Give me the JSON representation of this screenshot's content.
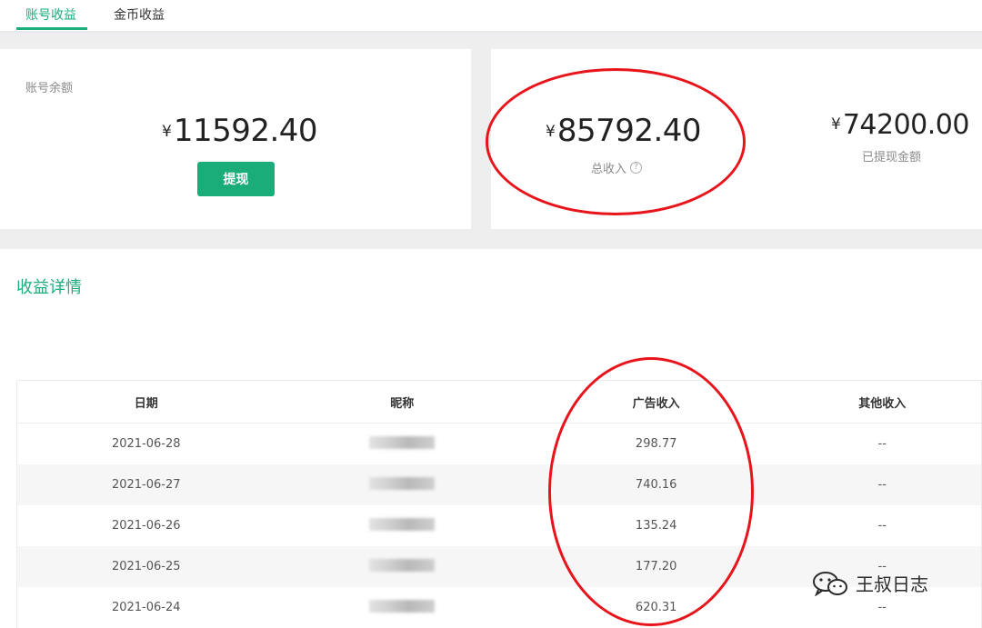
{
  "tabs": [
    {
      "label": "账号收益",
      "active": true
    },
    {
      "label": "金币收益",
      "active": false
    }
  ],
  "balance": {
    "label": "账号余额",
    "currency": "¥",
    "amount": "11592.40",
    "withdraw_label": "提现"
  },
  "income": {
    "total_currency": "¥",
    "total_amount": "85792.40",
    "total_label": "总收入",
    "withdrawn_currency": "¥",
    "withdrawn_amount": "74200.00",
    "withdrawn_label": "已提现金额"
  },
  "details": {
    "title": "收益详情",
    "columns": [
      "日期",
      "昵称",
      "广告收入",
      "其他收入"
    ],
    "rows": [
      {
        "date": "2021-06-28",
        "ad": "298.77",
        "other": "--"
      },
      {
        "date": "2021-06-27",
        "ad": "740.16",
        "other": "--"
      },
      {
        "date": "2021-06-26",
        "ad": "135.24",
        "other": "--"
      },
      {
        "date": "2021-06-25",
        "ad": "177.20",
        "other": "--"
      },
      {
        "date": "2021-06-24",
        "ad": "620.31",
        "other": "--"
      }
    ]
  },
  "watermark": {
    "text": "王叔日志",
    "icon": "wechat-icon"
  },
  "colors": {
    "accent": "#1aad7a",
    "annotation": "#e8141b"
  }
}
